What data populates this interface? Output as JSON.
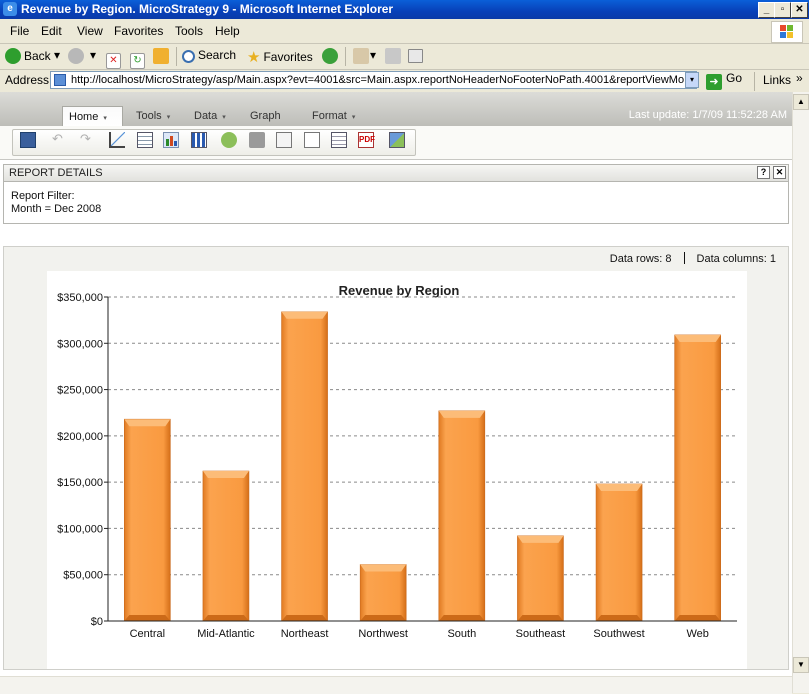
{
  "window": {
    "title": "Revenue by Region. MicroStrategy 9 - Microsoft Internet Explorer",
    "minimize_glyph": "_",
    "maximize_glyph": "▫",
    "close_glyph": "✕"
  },
  "menubar": {
    "items": [
      "File",
      "Edit",
      "View",
      "Favorites",
      "Tools",
      "Help"
    ]
  },
  "navbar": {
    "back_label": "Back",
    "search_label": "Search",
    "favorites_label": "Favorites",
    "dropdown_glyph": "▾"
  },
  "addressbar": {
    "label": "Address",
    "url": "http://localhost/MicroStrategy/asp/Main.aspx?evt=4001&src=Main.aspx.reportNoHeaderNoFooterNoPath.4001&reportViewMo",
    "go_label": "Go",
    "links_label": "Links",
    "more_glyph": "»"
  },
  "mstr": {
    "tabs": [
      "Home",
      "Tools",
      "Data",
      "Graph",
      "Format"
    ],
    "tab_arrow": "▾",
    "last_update": "Last update: 1/7/09 11:52:28 AM"
  },
  "report_details": {
    "title": "REPORT DETAILS",
    "help_glyph": "?",
    "close_glyph": "✕",
    "filter_label": "Report Filter:",
    "filter_value": "Month = Dec 2008"
  },
  "data_info": {
    "rows": "Data rows: 8",
    "columns": "Data columns: 1"
  },
  "chart_data": {
    "type": "bar",
    "title": "Revenue by Region",
    "categories": [
      "Central",
      "Mid-Atlantic",
      "Northeast",
      "Northwest",
      "South",
      "Southeast",
      "Southwest",
      "Web"
    ],
    "values": [
      218000,
      162000,
      334000,
      61000,
      227000,
      92000,
      148000,
      309000
    ],
    "ylim": [
      0,
      350000
    ],
    "yticks": [
      "$0",
      "$50,000",
      "$100,000",
      "$150,000",
      "$200,000",
      "$250,000",
      "$300,000",
      "$350,000"
    ],
    "ytick_values": [
      0,
      50000,
      100000,
      150000,
      200000,
      250000,
      300000,
      350000
    ],
    "grid": true,
    "bar_color": "#f5953a"
  },
  "scroll": {
    "up": "▲",
    "down": "▼",
    "left": "◀",
    "right": "▶"
  }
}
